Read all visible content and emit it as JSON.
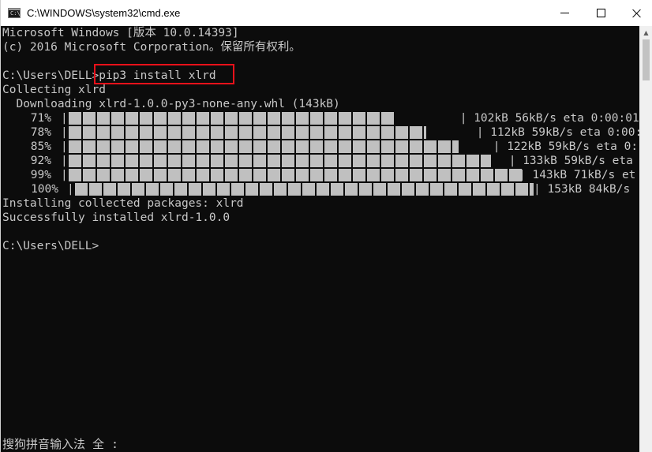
{
  "window": {
    "title": "C:\\WINDOWS\\system32\\cmd.exe",
    "icon_label": "C:\\"
  },
  "controls": {
    "minimize_icon": "minimize-icon",
    "maximize_icon": "maximize-icon",
    "close_icon": "close-icon"
  },
  "console": {
    "lines": [
      "Microsoft Windows [版本 10.0.14393]",
      "(c) 2016 Microsoft Corporation。保留所有权利。",
      "",
      "C:\\Users\\DELL>pip3 install xlrd",
      "Collecting xlrd",
      "  Downloading xlrd-1.0.0-py3-none-any.whl (143kB)"
    ],
    "progress": [
      {
        "percent_label": "71%",
        "fraction": 0.71,
        "tail": " | 102kB 56kB/s eta 0:00:01"
      },
      {
        "percent_label": "78%",
        "fraction": 0.78,
        "tail": " | 112kB 59kB/s eta 0:00:"
      },
      {
        "percent_label": "85%",
        "fraction": 0.85,
        "tail": " | 122kB 59kB/s eta 0:"
      },
      {
        "percent_label": "92%",
        "fraction": 0.92,
        "tail": " | 133kB 59kB/s eta"
      },
      {
        "percent_label": "99%",
        "fraction": 0.99,
        "tail": "| 143kB 71kB/s et"
      },
      {
        "percent_label": "100%",
        "fraction": 1.0,
        "tail": "| 153kB 84kB/s"
      }
    ],
    "after_lines": [
      "Installing collected packages: xlrd",
      "Successfully installed xlrd-1.0.0",
      "",
      "C:\\Users\\DELL>"
    ],
    "highlight_color": "#e8111a"
  },
  "ime": {
    "status": "搜狗拼音输入法 全 :"
  },
  "colors": {
    "console_bg": "#0c0c0c",
    "console_fg": "#c8c8c8",
    "titlebar_bg": "#ffffff",
    "progress_block": "#c0c0c0"
  }
}
